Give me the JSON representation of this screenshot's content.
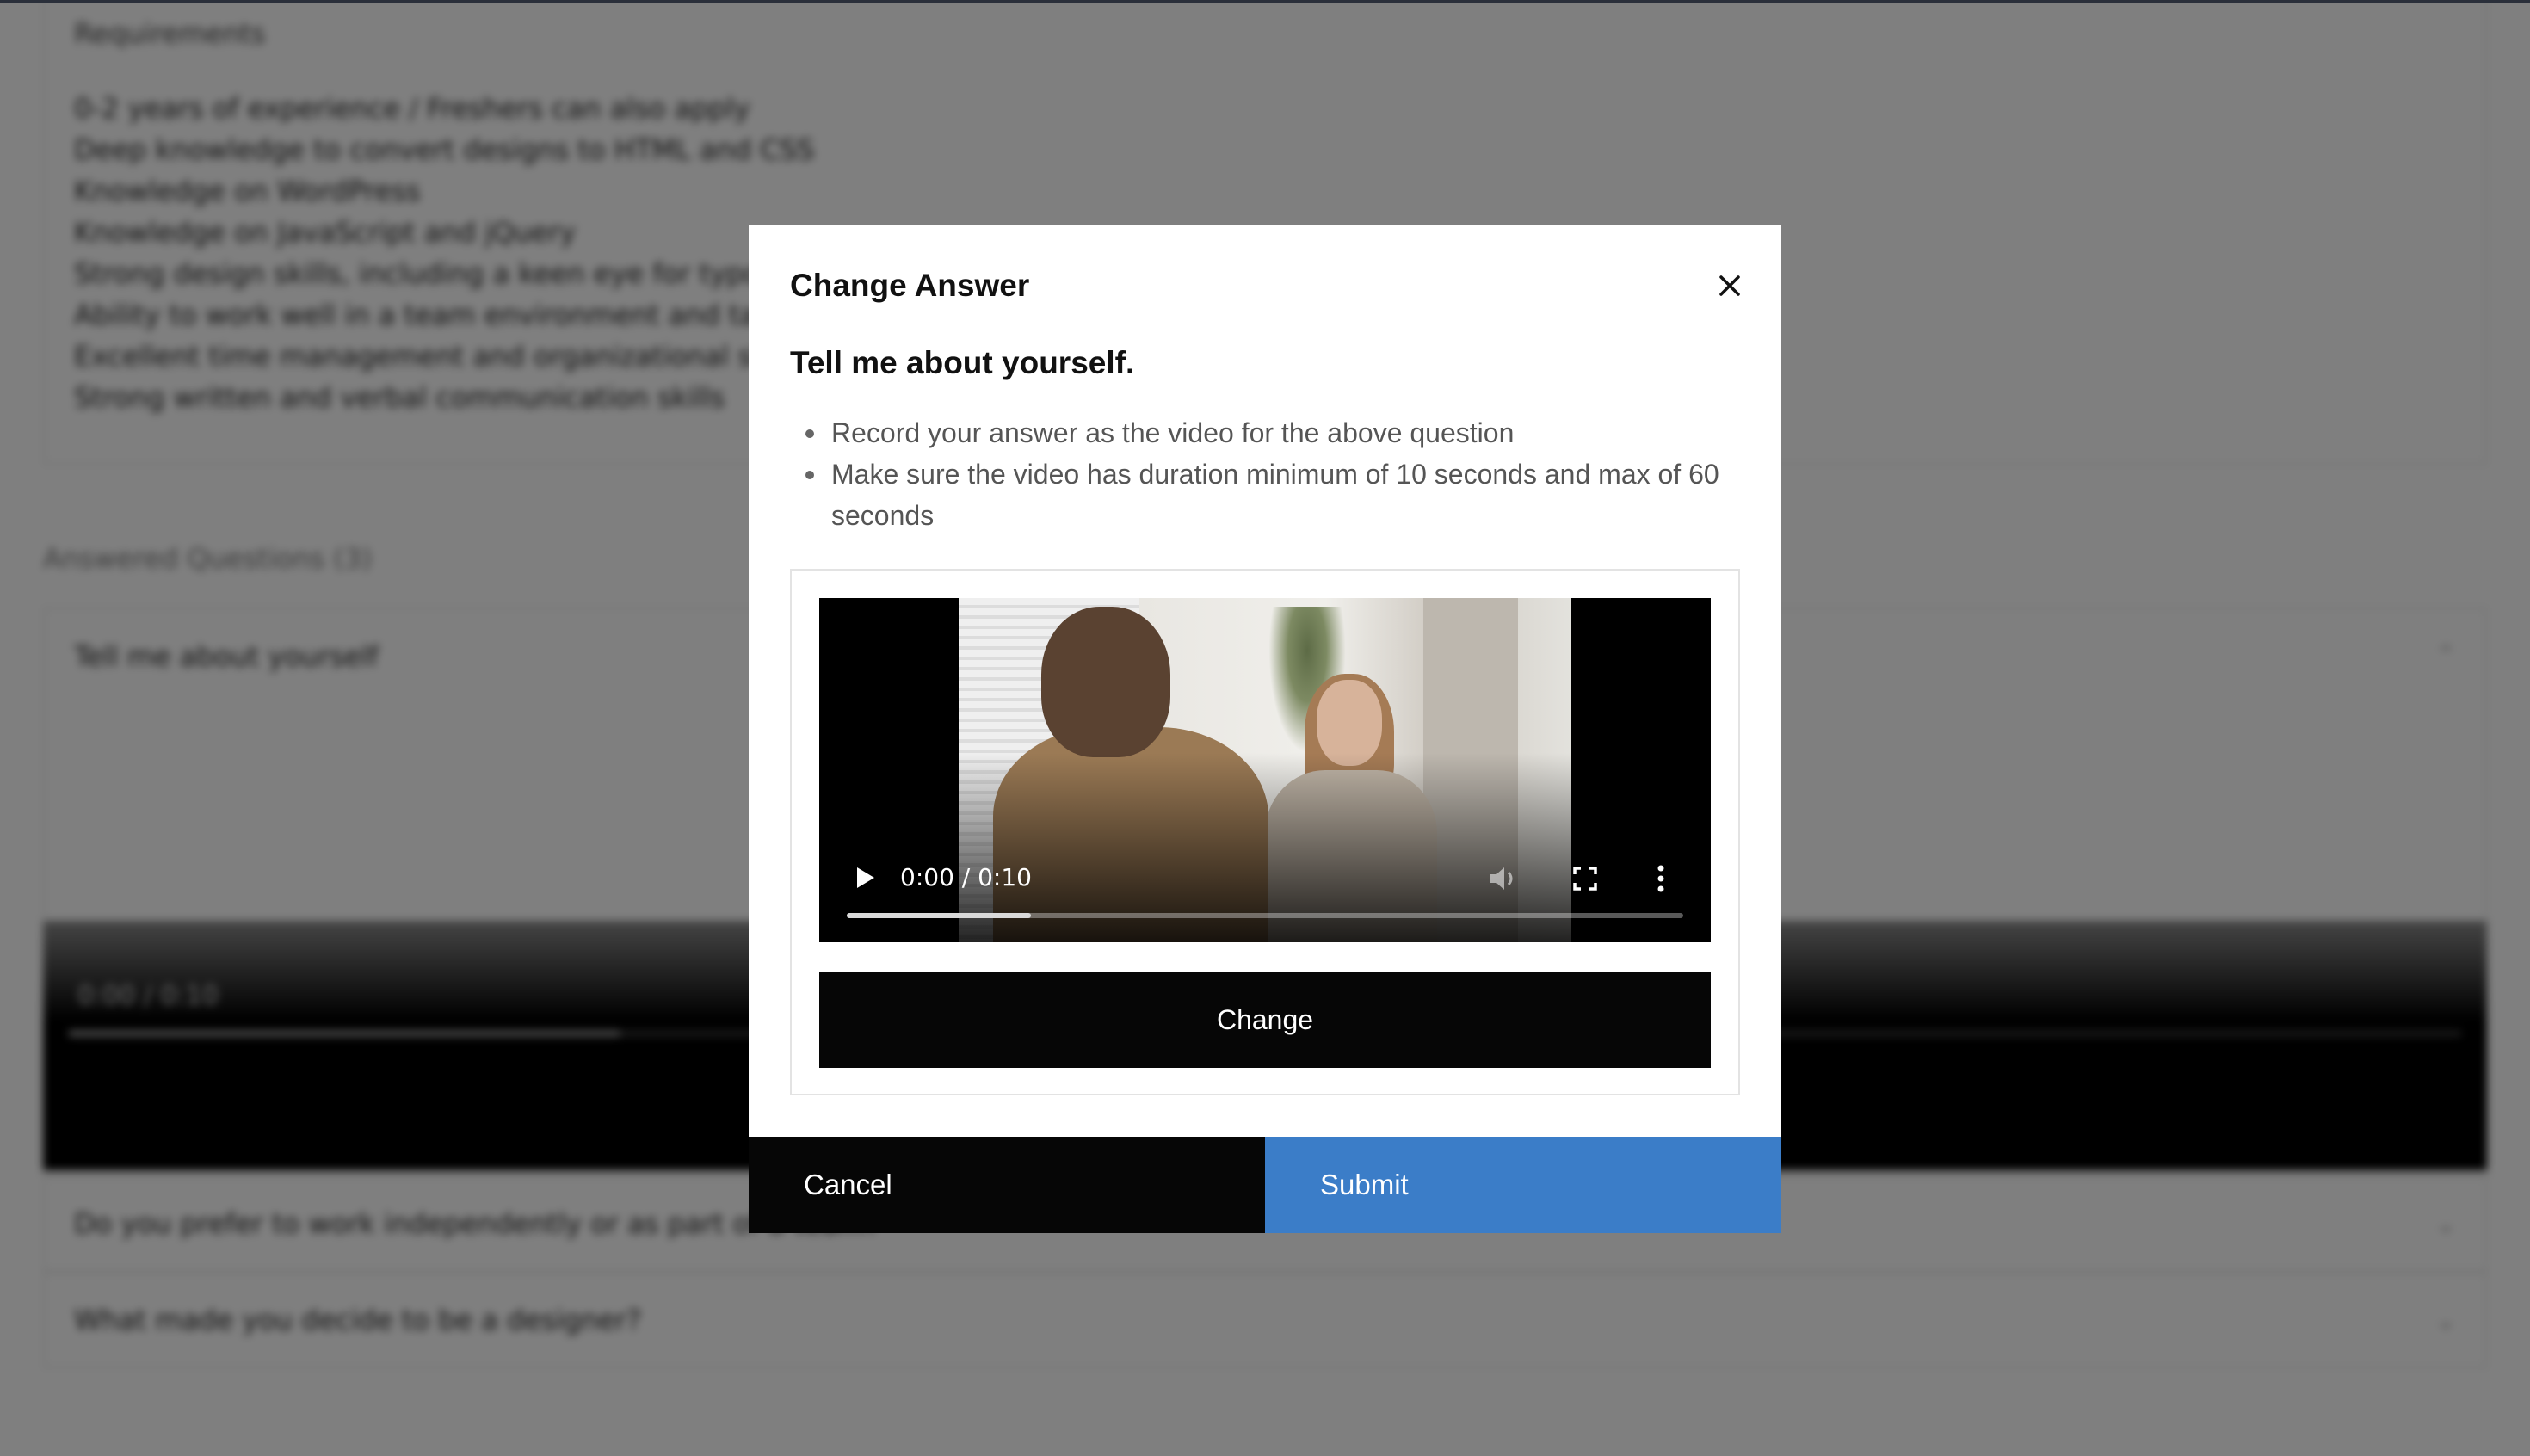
{
  "background": {
    "requirements_title": "Requirements",
    "requirements": [
      "0-2 years of experience / Freshers can also apply",
      "Deep knowledge to convert designs to HTML and CSS",
      "Knowledge on WordPress",
      "Knowledge on JavaScript and jQuery",
      "Strong design skills, including a keen eye for typography",
      "Ability to work well in a team environment and take direction",
      "Excellent time management and organizational skills",
      "Strong written and verbal communication skills"
    ],
    "answered_title": "Answered Questions (3)",
    "questions": [
      "Tell me about yourself",
      "Do you prefer to work independently or as part of a team?",
      "What made you decide to be a designer?"
    ],
    "video_time": "0:00 / 0:10"
  },
  "modal": {
    "title": "Change Answer",
    "question": "Tell me about yourself.",
    "rules": [
      "Record your answer as the video for the above question",
      "Make sure the video has duration minimum of 10 seconds and max of 60 seconds"
    ],
    "video": {
      "time": "0:00 / 0:10",
      "progress": 0.22
    },
    "change_label": "Change",
    "cancel_label": "Cancel",
    "submit_label": "Submit"
  },
  "colors": {
    "submit": "#3b7dc8",
    "dark_button": "#060606",
    "overlay": "rgba(0,0,0,0.5)"
  }
}
